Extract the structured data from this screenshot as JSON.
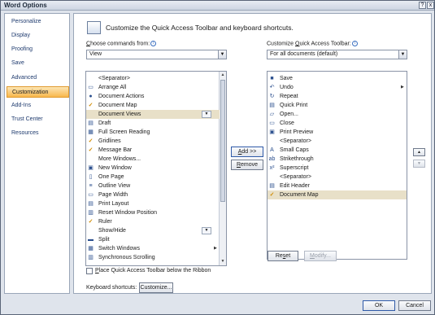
{
  "window": {
    "title": "Word Options",
    "help_glyph": "?",
    "close_glyph": "x"
  },
  "nav": {
    "items": [
      {
        "label": "Personalize"
      },
      {
        "label": "Display"
      },
      {
        "label": "Proofing"
      },
      {
        "label": "Save"
      },
      {
        "label": "Advanced"
      },
      {
        "label": "Customization",
        "selected": true
      },
      {
        "label": "Add-Ins"
      },
      {
        "label": "Trust Center"
      },
      {
        "label": "Resources"
      }
    ]
  },
  "header": {
    "text": "Customize the Quick Access Toolbar and keyboard shortcuts."
  },
  "choose": {
    "label_u": "C",
    "label_rest": "hoose commands from:",
    "value": "View"
  },
  "customize": {
    "label_pre": "Customize ",
    "label_u": "Q",
    "label_rest": "uick Access Toolbar:",
    "value": "For all documents (default)"
  },
  "commands": [
    {
      "label": "<Separator>",
      "icon": ""
    },
    {
      "label": "Arrange All",
      "icon": "▭"
    },
    {
      "label": "Document Actions",
      "icon": "●"
    },
    {
      "label": "Document Map",
      "icon": "✓",
      "checked": true
    },
    {
      "label": "Document Views",
      "icon": "",
      "selected": true,
      "dropdown": true
    },
    {
      "label": "Draft",
      "icon": "▤"
    },
    {
      "label": "Full Screen Reading",
      "icon": "▦"
    },
    {
      "label": "Gridlines",
      "icon": "✓",
      "checked": true
    },
    {
      "label": "Message Bar",
      "icon": "✓",
      "checked": true
    },
    {
      "label": "More Windows...",
      "icon": ""
    },
    {
      "label": "New Window",
      "icon": "▣"
    },
    {
      "label": "One Page",
      "icon": "▯"
    },
    {
      "label": "Outline View",
      "icon": "≡"
    },
    {
      "label": "Page Width",
      "icon": "▭"
    },
    {
      "label": "Print Layout",
      "icon": "▤"
    },
    {
      "label": "Reset Window Position",
      "icon": "▥"
    },
    {
      "label": "Ruler",
      "icon": "✓",
      "checked": true
    },
    {
      "label": "Show/Hide",
      "icon": "",
      "dropdown": true
    },
    {
      "label": "Split",
      "icon": "▬"
    },
    {
      "label": "Switch Windows",
      "icon": "▦",
      "submenu": true
    },
    {
      "label": "Synchronous Scrolling",
      "icon": "▥"
    }
  ],
  "toolbar": [
    {
      "label": "Save",
      "icon": "■"
    },
    {
      "label": "Undo",
      "icon": "↶",
      "submenu": true
    },
    {
      "label": "Repeat",
      "icon": "↻"
    },
    {
      "label": "Quick Print",
      "icon": "▤"
    },
    {
      "label": "Open...",
      "icon": "▱"
    },
    {
      "label": "Close",
      "icon": "▭"
    },
    {
      "label": "Print Preview",
      "icon": "▣"
    },
    {
      "label": "<Separator>",
      "icon": ""
    },
    {
      "label": "Small Caps",
      "icon": "A"
    },
    {
      "label": "Strikethrough",
      "icon": "ab"
    },
    {
      "label": "Superscript",
      "icon": "x²"
    },
    {
      "label": "<Separator>",
      "icon": ""
    },
    {
      "label": "Edit Header",
      "icon": "▤"
    },
    {
      "label": "Document Map",
      "icon": "✓",
      "checked": true,
      "selected": true
    }
  ],
  "buttons": {
    "add_u": "A",
    "add_rest": "dd >>",
    "remove_u": "R",
    "remove_rest": "emove",
    "reset_pre": "Re",
    "reset_u": "s",
    "reset_rest": "et",
    "modify_u": "M",
    "modify_rest": "odify...",
    "customize": "Customize...",
    "ok": "OK",
    "cancel": "Cancel",
    "move_up": "▲",
    "move_down": "▼"
  },
  "place_below": {
    "u": "P",
    "rest": "lace Quick Access Toolbar below the Ribbon"
  },
  "keyboard": {
    "label": "Keyboard shortcuts:"
  }
}
